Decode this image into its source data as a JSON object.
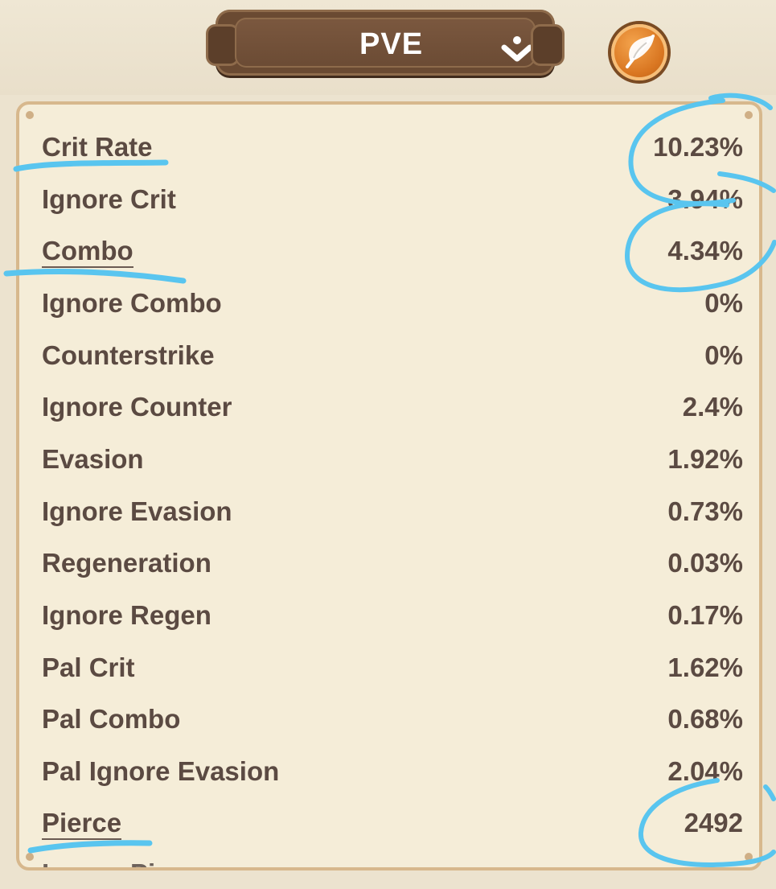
{
  "header": {
    "mode_label": "PVE",
    "mode_dropdown_icon": "chevron-down-icon",
    "edit_icon": "feather-icon"
  },
  "stats": [
    {
      "label": "Crit Rate",
      "value": "10.23%"
    },
    {
      "label": "Ignore Crit",
      "value": "3.94%"
    },
    {
      "label": "Combo",
      "value": "4.34%"
    },
    {
      "label": "Ignore Combo",
      "value": "0%"
    },
    {
      "label": "Counterstrike",
      "value": "0%"
    },
    {
      "label": "Ignore Counter",
      "value": "2.4%"
    },
    {
      "label": "Evasion",
      "value": "1.92%"
    },
    {
      "label": "Ignore Evasion",
      "value": "0.73%"
    },
    {
      "label": "Regeneration",
      "value": "0.03%"
    },
    {
      "label": "Ignore Regen",
      "value": "0.17%"
    },
    {
      "label": "Pal Crit",
      "value": "1.62%"
    },
    {
      "label": "Pal Combo",
      "value": "0.68%"
    },
    {
      "label": "Pal Ignore Evasion",
      "value": "2.04%"
    },
    {
      "label": "Pierce",
      "value": "2492"
    },
    {
      "label": "Ignore Pierce",
      "value": ""
    }
  ],
  "colors": {
    "background": "#ece3cf",
    "panel": "#f5edd8",
    "panel_border": "#d7b88d",
    "text": "#5b4a42",
    "wood": "#6a4a32",
    "orange_button": "#d97621",
    "ink_marks": "#59c5ef"
  }
}
